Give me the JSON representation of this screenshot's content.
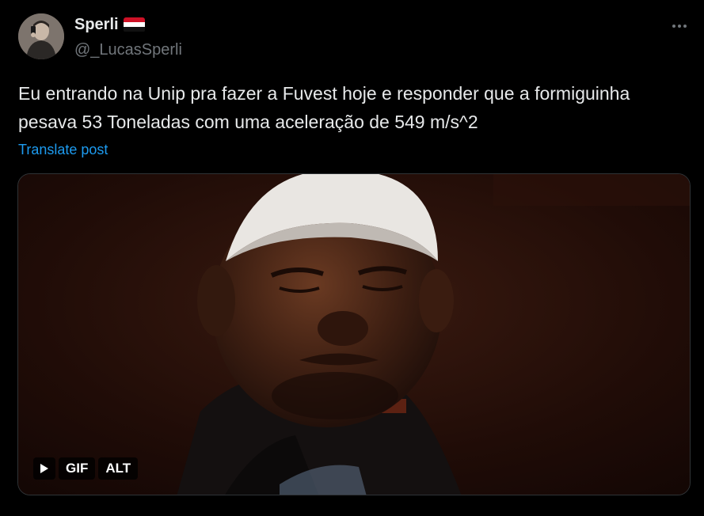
{
  "author": {
    "display_name": "Sperli",
    "handle": "@_LucasSperli",
    "flag_icon": "egypt-flag-icon",
    "flag_colors": [
      "#ce1126",
      "#ffffff",
      "#000000"
    ]
  },
  "more_icon": "more-horizontal-icon",
  "tweet": {
    "text": "Eu entrando na Unip pra fazer a Fuvest hoje e responder que a formiguinha pesava 53 Toneladas com uma aceleração de 549 m/s^2",
    "translate_label": "Translate post"
  },
  "media": {
    "play_icon": "play-icon",
    "gif_label": "GIF",
    "alt_label": "ALT"
  },
  "colors": {
    "background": "#000000",
    "text_primary": "#e7e9ea",
    "text_secondary": "#71767b",
    "link": "#1d9bf0",
    "border": "#2f3336"
  }
}
